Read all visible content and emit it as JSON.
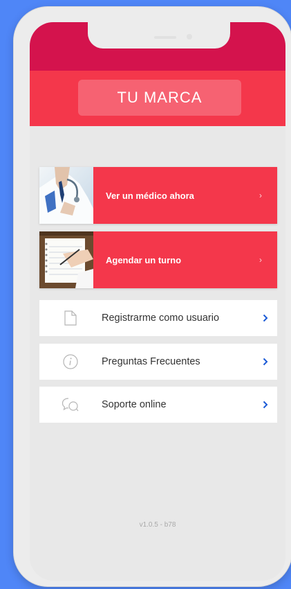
{
  "header": {
    "brand": "TU MARCA"
  },
  "features": [
    {
      "label": "Ver un médico ahora",
      "chevron": "›",
      "image": "doctor-photo"
    },
    {
      "label": "Agendar un turno",
      "chevron": "›",
      "image": "notebook-writing-photo"
    }
  ],
  "menu": [
    {
      "label": "Registrarme como usuario",
      "icon": "document-icon"
    },
    {
      "label": "Preguntas Frecuentes",
      "icon": "info-icon"
    },
    {
      "label": "Soporte online",
      "icon": "chat-bubbles-icon"
    }
  ],
  "footer": {
    "version": "v1.0.5 - b78"
  },
  "colors": {
    "background": "#4f86f7",
    "status_bar": "#d4134d",
    "primary_red": "#f4374b",
    "chevron_blue": "#1a5ad6",
    "screen_bg": "#e8e8e8"
  }
}
